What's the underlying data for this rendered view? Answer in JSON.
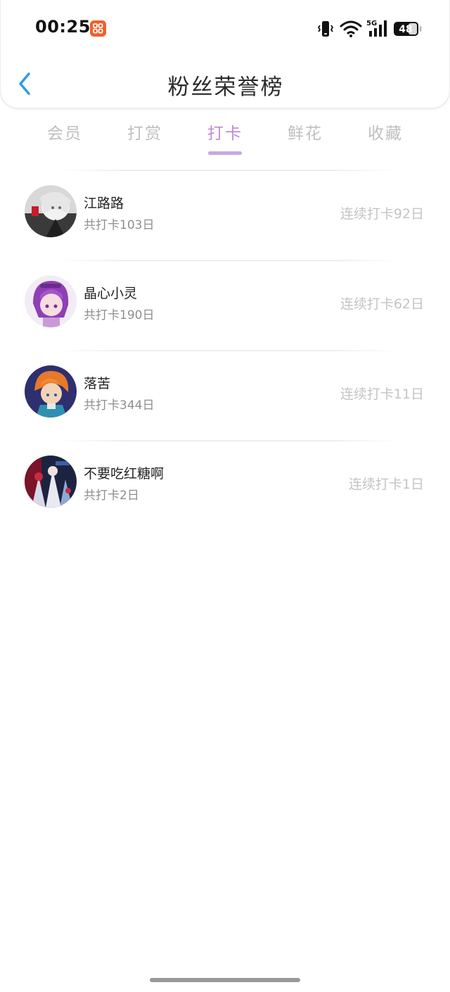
{
  "status_bar": {
    "time": "00:25",
    "network": "5G",
    "battery": "48"
  },
  "header": {
    "title": "粉丝荣誉榜"
  },
  "tabs": [
    {
      "label": "会员",
      "active": false
    },
    {
      "label": "打赏",
      "active": false
    },
    {
      "label": "打卡",
      "active": true
    },
    {
      "label": "鲜花",
      "active": false
    },
    {
      "label": "收藏",
      "active": false
    }
  ],
  "fans": [
    {
      "name": "江路路",
      "total": "共打卡103日",
      "streak": "连续打卡92日"
    },
    {
      "name": "晶心小灵",
      "total": "共打卡190日",
      "streak": "连续打卡62日"
    },
    {
      "name": "落苦",
      "total": "共打卡344日",
      "streak": "连续打卡11日"
    },
    {
      "name": "不要吃红糖啊",
      "total": "共打卡2日",
      "streak": "连续打卡1日"
    }
  ],
  "colors": {
    "accent": "#c08ad6",
    "accent_underline": "#c9a6e3",
    "back_arrow": "#2f9be6",
    "tab_inactive": "#bfbfbf",
    "app_notification": "#f0612a"
  }
}
